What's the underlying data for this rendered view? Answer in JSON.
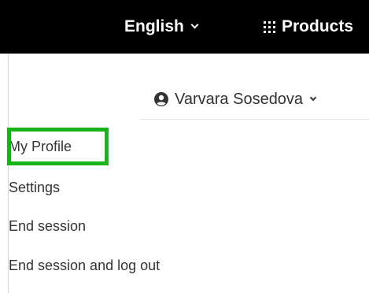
{
  "header": {
    "language_label": "English",
    "products_label": "Products",
    "icons": {
      "language_chevron": "chevron-down-icon",
      "products": "grid-icon"
    },
    "background_color": "#000000",
    "text_color": "#ffffff"
  },
  "user_menu": {
    "user_name": "Varvara Sosedova",
    "icons": {
      "user": "user-circle-icon",
      "chevron": "chevron-down-icon"
    },
    "items": [
      {
        "label": "My Profile",
        "highlighted": true
      },
      {
        "label": "Settings"
      },
      {
        "label": "End session"
      },
      {
        "label": "End session and log out"
      }
    ]
  },
  "colors": {
    "highlight": "#18b21a",
    "menu_text": "#333333"
  }
}
